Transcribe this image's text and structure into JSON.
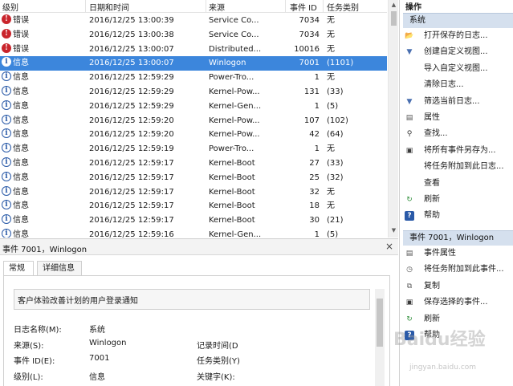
{
  "list": {
    "headers": {
      "level": "级别",
      "date": "日期和时间",
      "source": "来源",
      "event_id": "事件 ID",
      "task": "任务类别"
    },
    "rows": [
      {
        "level": "错误",
        "kind": "err",
        "date": "2016/12/25 13:00:39",
        "source": "Service Co...",
        "id": "7034",
        "task": "无"
      },
      {
        "level": "错误",
        "kind": "err",
        "date": "2016/12/25 13:00:38",
        "source": "Service Co...",
        "id": "7034",
        "task": "无"
      },
      {
        "level": "错误",
        "kind": "err",
        "date": "2016/12/25 13:00:07",
        "source": "Distributed...",
        "id": "10016",
        "task": "无"
      },
      {
        "level": "信息",
        "kind": "info",
        "date": "2016/12/25 13:00:07",
        "source": "Winlogon",
        "id": "7001",
        "task": "(1101)",
        "selected": true
      },
      {
        "level": "信息",
        "kind": "info",
        "date": "2016/12/25 12:59:29",
        "source": "Power-Tro...",
        "id": "1",
        "task": "无"
      },
      {
        "level": "信息",
        "kind": "info",
        "date": "2016/12/25 12:59:29",
        "source": "Kernel-Pow...",
        "id": "131",
        "task": "(33)"
      },
      {
        "level": "信息",
        "kind": "info",
        "date": "2016/12/25 12:59:29",
        "source": "Kernel-Gen...",
        "id": "1",
        "task": "(5)"
      },
      {
        "level": "信息",
        "kind": "info",
        "date": "2016/12/25 12:59:20",
        "source": "Kernel-Pow...",
        "id": "107",
        "task": "(102)"
      },
      {
        "level": "信息",
        "kind": "info",
        "date": "2016/12/25 12:59:20",
        "source": "Kernel-Pow...",
        "id": "42",
        "task": "(64)"
      },
      {
        "level": "信息",
        "kind": "info",
        "date": "2016/12/25 12:59:19",
        "source": "Power-Tro...",
        "id": "1",
        "task": "无"
      },
      {
        "level": "信息",
        "kind": "info",
        "date": "2016/12/25 12:59:17",
        "source": "Kernel-Boot",
        "id": "27",
        "task": "(33)"
      },
      {
        "level": "信息",
        "kind": "info",
        "date": "2016/12/25 12:59:17",
        "source": "Kernel-Boot",
        "id": "25",
        "task": "(32)"
      },
      {
        "level": "信息",
        "kind": "info",
        "date": "2016/12/25 12:59:17",
        "source": "Kernel-Boot",
        "id": "32",
        "task": "无"
      },
      {
        "level": "信息",
        "kind": "info",
        "date": "2016/12/25 12:59:17",
        "source": "Kernel-Boot",
        "id": "18",
        "task": "无"
      },
      {
        "level": "信息",
        "kind": "info",
        "date": "2016/12/25 12:59:17",
        "source": "Kernel-Boot",
        "id": "30",
        "task": "(21)"
      },
      {
        "level": "信息",
        "kind": "info",
        "date": "2016/12/25 12:59:16",
        "source": "Kernel-Gen...",
        "id": "1",
        "task": "(5)"
      }
    ]
  },
  "detail": {
    "title": "事件 7001，Winlogon",
    "close": "×",
    "tabs": [
      "常规",
      "详细信息"
    ],
    "description": "客户体验改善计划的用户登录通知",
    "fields": {
      "log_name_label": "日志名称(M):",
      "log_name_value": "系统",
      "source_label": "来源(S):",
      "source_value": "Winlogon",
      "event_id_label": "事件 ID(E):",
      "event_id_value": "7001",
      "level_label": "级别(L):",
      "level_value": "信息",
      "logged_label": "记录时间(D",
      "task_label": "任务类别(Y)",
      "keywords_label": "关键字(K):"
    }
  },
  "actions": {
    "title": "操作",
    "section1": "系统",
    "section1_items": [
      {
        "icon": "folder-open-icon",
        "label": "打开保存的日志..."
      },
      {
        "icon": "filter-icon",
        "label": "创建自定义视图..."
      },
      {
        "icon": "",
        "label": "导入自定义视图..."
      },
      {
        "icon": "",
        "label": "清除日志..."
      },
      {
        "icon": "filter-icon",
        "label": "筛选当前日志..."
      },
      {
        "icon": "properties-icon",
        "label": "属性"
      },
      {
        "icon": "find-icon",
        "label": "查找..."
      },
      {
        "icon": "save-icon",
        "label": "将所有事件另存为..."
      },
      {
        "icon": "",
        "label": "将任务附加到此日志..."
      },
      {
        "icon": "",
        "label": "查看"
      },
      {
        "icon": "refresh-icon",
        "label": "刷新"
      },
      {
        "icon": "help-icon",
        "label": "帮助"
      }
    ],
    "section2": "事件 7001，Winlogon",
    "section2_items": [
      {
        "icon": "properties-icon",
        "label": "事件属性"
      },
      {
        "icon": "task-icon",
        "label": "将任务附加到此事件..."
      },
      {
        "icon": "copy-icon",
        "label": "复制"
      },
      {
        "icon": "save-icon",
        "label": "保存选择的事件..."
      },
      {
        "icon": "refresh-icon",
        "label": "刷新"
      },
      {
        "icon": "help-icon",
        "label": "帮助"
      }
    ]
  },
  "watermark": {
    "text": "Baidu经验",
    "sub": "jingyan.baidu.com"
  },
  "colors": {
    "selection": "#3c86dc",
    "section_bg": "#d5e0ee",
    "error": "#c9252c",
    "info": "#2a5aa8"
  }
}
